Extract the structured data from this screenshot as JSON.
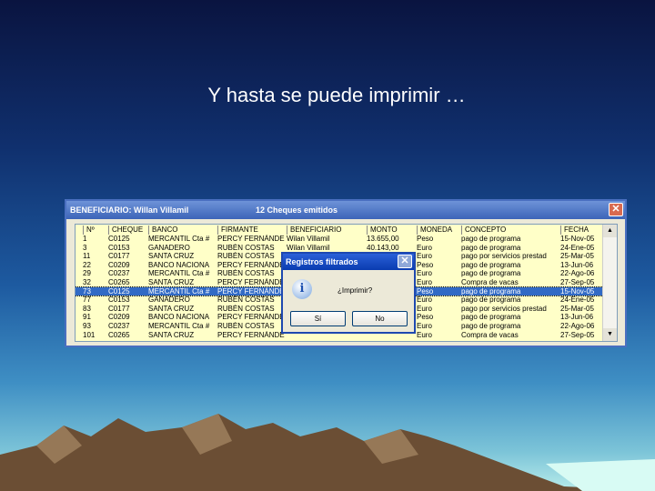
{
  "slide_title": "Y hasta se puede imprimir …",
  "window": {
    "title": "BENEFICIARIO:  Willan Villamil",
    "count": "12  Cheques emitidos",
    "close": "✕"
  },
  "columns": [
    "Nº",
    "CHEQUE",
    "BANCO",
    "FIRMANTE",
    "BENEFICIARIO",
    "MONTO",
    "MONEDA",
    "CONCEPTO",
    "FECHA"
  ],
  "rows": [
    [
      "1",
      "C0125",
      "MERCANTIL Cta #",
      "PERCY FERNÁNDE",
      "Wilan Villamil",
      "13.655,00",
      "Peso",
      "pago de programa",
      "15-Nov-05"
    ],
    [
      "3",
      "C0153",
      "GANADERO",
      "RUBÉN COSTAS",
      "Wilan Villamil",
      "40.143,00",
      "Euro",
      "pago de programa",
      "24-Ene-05"
    ],
    [
      "11",
      "C0177",
      "SANTA CRUZ",
      "RUBÉN COSTAS",
      "",
      "",
      "Euro",
      "pago por servicios prestad",
      "25-Mar-05"
    ],
    [
      "22",
      "C0209",
      "BANCO NACIONA",
      "PERCY FERNÁNDE",
      "",
      "",
      "Peso",
      "pago de programa",
      "13-Jun-06"
    ],
    [
      "29",
      "C0237",
      "MERCANTIL Cta #",
      "RUBÉN COSTAS",
      "",
      "",
      "Euro",
      "pago de programa",
      "22-Ago-06"
    ],
    [
      "32",
      "C0265",
      "SANTA CRUZ",
      "PERCY FERNÁNDE",
      "",
      "",
      "Euro",
      "Compra de vacas",
      "27-Sep-05"
    ],
    [
      "73",
      "C0125",
      "MERCANTIL Cta #",
      "PERCY FERNÁNDE",
      "",
      "",
      "Peso",
      "pago de programa",
      "15-Nov-05"
    ],
    [
      "77",
      "C0153",
      "GANADERO",
      "RUBÉN COSTAS",
      "",
      "",
      "Euro",
      "pago de programa",
      "24-Ene-05"
    ],
    [
      "83",
      "C0177",
      "SANTA CRUZ",
      "RUBÉN COSTAS",
      "",
      "",
      "Euro",
      "pago por servicios prestad",
      "25-Mar-05"
    ],
    [
      "91",
      "C0209",
      "BANCO NACIONA",
      "PERCY FERNÁNDE",
      "",
      "",
      "Peso",
      "pago de programa",
      "13-Jun-06"
    ],
    [
      "93",
      "C0237",
      "MERCANTIL Cta #",
      "RUBÉN COSTAS",
      "",
      "",
      "Euro",
      "pago de programa",
      "22-Ago-06"
    ],
    [
      "101",
      "C0265",
      "SANTA CRUZ",
      "PERCY FERNÁNDE",
      "",
      "",
      "Euro",
      "Compra de vacas",
      "27-Sep-05"
    ]
  ],
  "selected_row": 6,
  "dialog": {
    "title": "Registros filtrados",
    "message": "¿Imprimir?",
    "yes": "Sí",
    "no": "No",
    "icon": "i"
  }
}
